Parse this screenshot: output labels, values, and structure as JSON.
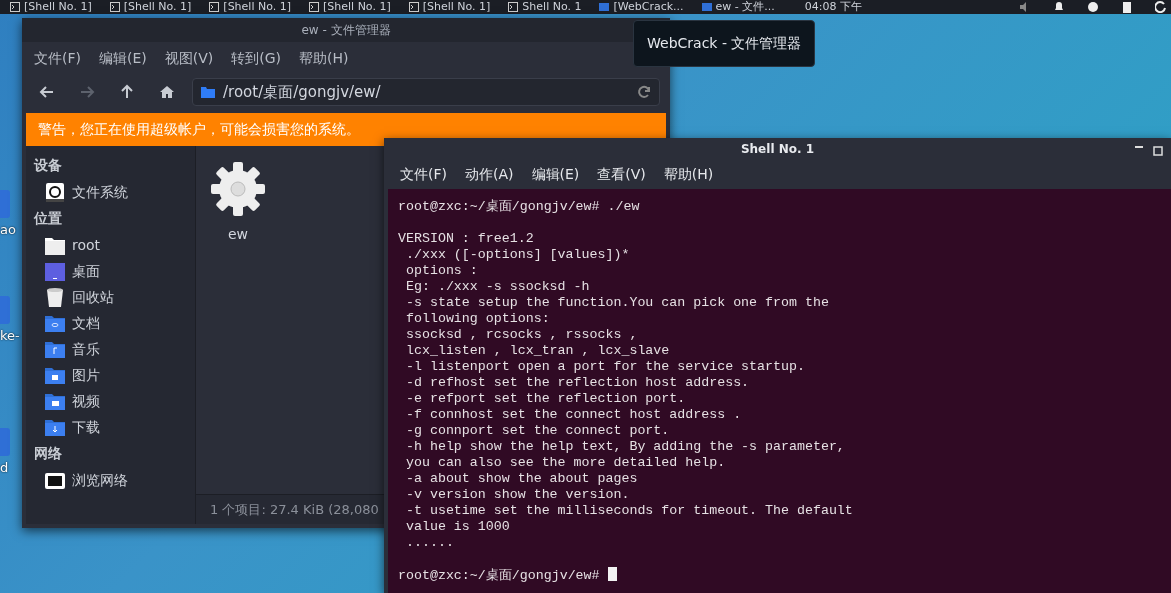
{
  "taskbar": {
    "tasks": [
      {
        "label": "[Shell No. 1]",
        "kind": "terminal"
      },
      {
        "label": "[Shell No. 1]",
        "kind": "terminal"
      },
      {
        "label": "[Shell No. 1]",
        "kind": "terminal"
      },
      {
        "label": "[Shell No. 1]",
        "kind": "terminal"
      },
      {
        "label": "[Shell No. 1]",
        "kind": "terminal"
      },
      {
        "label": "Shell No. 1",
        "kind": "terminal"
      },
      {
        "label": "[WebCrack...",
        "kind": "folder"
      },
      {
        "label": "ew - 文件...",
        "kind": "folder"
      }
    ],
    "clock": "04:08 下午"
  },
  "desktop_icons": [
    {
      "label": "ao"
    },
    {
      "label": "ke-"
    },
    {
      "label": "d"
    }
  ],
  "file_manager": {
    "title": "ew - 文件管理器",
    "menu": [
      "文件(F)",
      "编辑(E)",
      "视图(V)",
      "转到(G)",
      "帮助(H)"
    ],
    "toolbar": [
      {
        "kind": "back",
        "disabled": false
      },
      {
        "kind": "forward",
        "disabled": true
      },
      {
        "kind": "up",
        "disabled": false
      },
      {
        "kind": "home",
        "disabled": false
      }
    ],
    "path": "/root/桌面/gongjv/ew/",
    "warning": "警告，您正在使用超级帐户，可能会损害您的系统。",
    "sidebar": [
      {
        "heading": "设备",
        "items": [
          {
            "label": "文件系统",
            "kind": "drive"
          }
        ]
      },
      {
        "heading": "位置",
        "items": [
          {
            "label": "root",
            "kind": "home"
          },
          {
            "label": "桌面",
            "kind": "desktop"
          },
          {
            "label": "回收站",
            "kind": "trash"
          },
          {
            "label": "文档",
            "kind": "documents"
          },
          {
            "label": "音乐",
            "kind": "music"
          },
          {
            "label": "图片",
            "kind": "pictures"
          },
          {
            "label": "视频",
            "kind": "videos"
          },
          {
            "label": "下载",
            "kind": "downloads"
          }
        ]
      },
      {
        "heading": "网络",
        "items": [
          {
            "label": "浏览网络",
            "kind": "network"
          }
        ]
      }
    ],
    "files": [
      {
        "name": "ew",
        "kind": "executable"
      }
    ],
    "status": "1 个项目: 27.4 KiB (28,080"
  },
  "tooltip": "WebCrack - 文件管理器",
  "terminal": {
    "title": "Shell No. 1",
    "menu": [
      "文件(F)",
      "动作(A)",
      "编辑(E)",
      "查看(V)",
      "帮助(H)"
    ],
    "blocks": [
      [
        "root@zxc:~/桌面/gongjv/ew# ./ew"
      ],
      [
        "VERSION : free1.2",
        " ./xxx ([-options] [values])*",
        " options :",
        " Eg: ./xxx -s ssocksd -h",
        " -s state setup the function.You can pick one from the",
        " following options:",
        " ssocksd , rcsocks , rssocks ,",
        " lcx_listen , lcx_tran , lcx_slave",
        " -l listenport open a port for the service startup.",
        " -d refhost set the reflection host address.",
        " -e refport set the reflection port.",
        " -f connhost set the connect host address .",
        " -g connport set the connect port.",
        " -h help show the help text, By adding the -s parameter,",
        " you can also see the more detailed help.",
        " -a about show the about pages",
        " -v version show the version.",
        " -t usetime set the milliseconds for timeout. The default",
        " value is 1000",
        " ......"
      ]
    ],
    "prompt": "root@zxc:~/桌面/gongjv/ew#",
    "cursor": true
  }
}
